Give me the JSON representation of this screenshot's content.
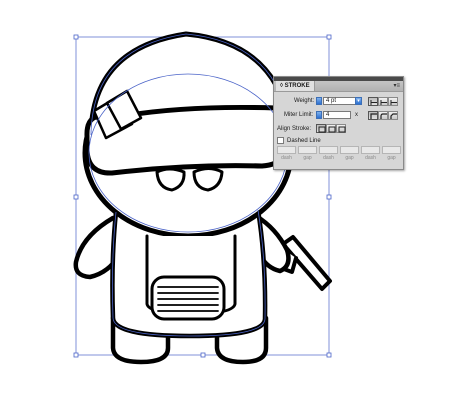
{
  "panel": {
    "title": "STROKE",
    "menu_icon": "panel-menu-icon",
    "weight_label": "Weight:",
    "weight_value": "4 pt",
    "miter_label": "Miter Limit:",
    "miter_value": "4",
    "miter_unit": "x",
    "align_label": "Align Stroke:",
    "dashed_label": "Dashed Line",
    "dashed_checked": false,
    "dash_gap": [
      "dash",
      "gap",
      "dash",
      "gap",
      "dash",
      "gap"
    ]
  },
  "colors": {
    "selection": "#4a63c8",
    "panel_bg": "#d6d6d6",
    "spinner_blue": "#2c6fd1"
  }
}
